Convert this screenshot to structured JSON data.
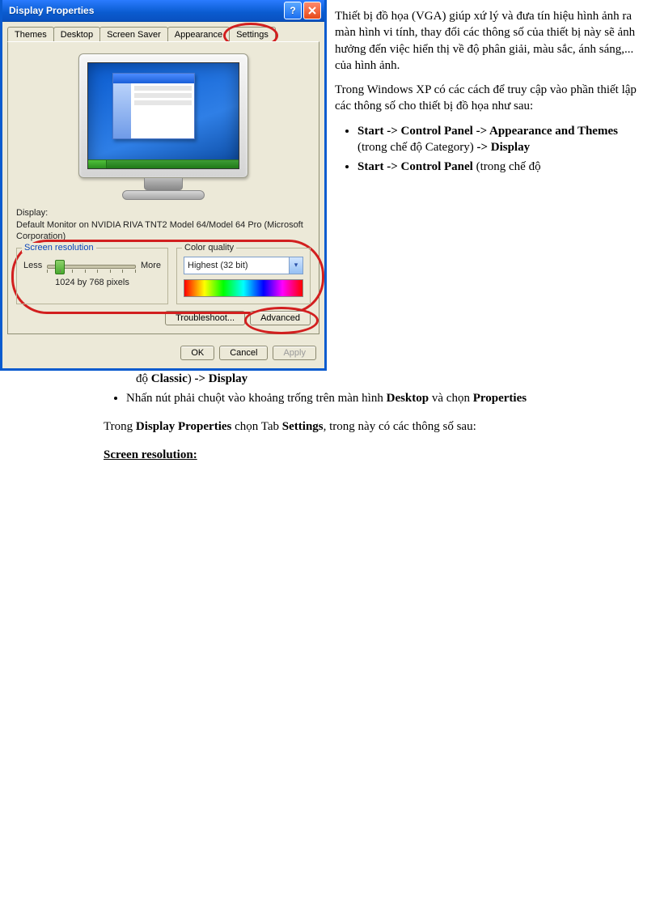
{
  "dialog": {
    "title": "Display Properties",
    "tabs": [
      "Themes",
      "Desktop",
      "Screen Saver",
      "Appearance",
      "Settings"
    ],
    "display_label": "Display:",
    "display_value": "Default Monitor on NVIDIA RIVA TNT2 Model 64/Model 64 Pro (Microsoft Corporation)",
    "screen_resolution": {
      "title": "Screen resolution",
      "less": "Less",
      "more": "More",
      "value": "1024 by 768 pixels"
    },
    "color_quality": {
      "title": "Color quality",
      "selected": "Highest (32 bit)"
    },
    "buttons": {
      "troubleshoot": "Troubleshoot...",
      "advanced": "Advanced",
      "ok": "OK",
      "cancel": "Cancel",
      "apply": "Apply"
    }
  },
  "doc": {
    "p1": "Thiết bị đồ họa (VGA) giúp xứ lý và đưa tín hiệu hình ảnh ra màn hình vi tính, thay đổi các thông số của thiết bị này sẽ ảnh hưởng đến việc hiển thị về độ phân giải, màu sắc, ánh sáng,... của hình ảnh.",
    "p2": "Trong Windows XP có các cách để truy cập vào phần thiết lập các thông số cho thiết bị đồ họa như sau:",
    "li1a": "Start -> Control Panel -> Appearance and Themes",
    "li1b": " (trong chế độ Category) ",
    "li1c": "-> Display",
    "li2a": "Start -> Control Panel",
    "li2b": " (trong chế độ ",
    "li2c": "Classic",
    "li2d": ") ",
    "li2e": "-> Display",
    "li3a": "Nhấn nút phải chuột vào khoảng trống trên màn hình ",
    "li3b": "Desktop",
    "li3c": " và chọn ",
    "li3d": "Properties",
    "p3a": "Trong ",
    "p3b": "Display Properties",
    "p3c": " chọn Tab ",
    "p3d": "Settings",
    "p3e": ", trong này có các thông số sau:",
    "h1": "Screen resolution:"
  }
}
